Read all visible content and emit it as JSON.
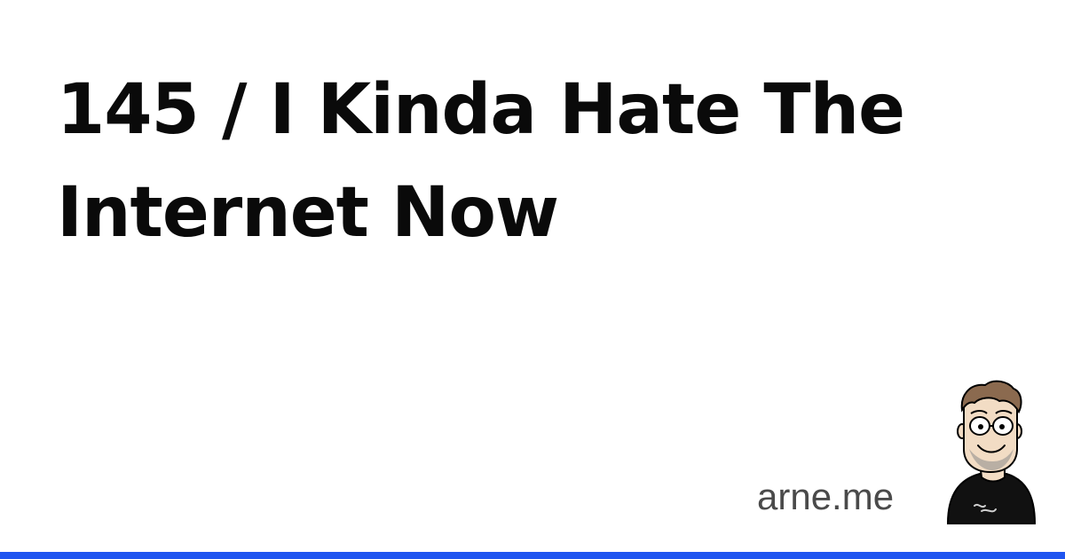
{
  "card": {
    "title": "145 / I Kinda Hate The Internet Now",
    "site": "arne.me",
    "avatar_icon": "cartoon-avatar-icon",
    "accent_color": "#1f55f0"
  }
}
